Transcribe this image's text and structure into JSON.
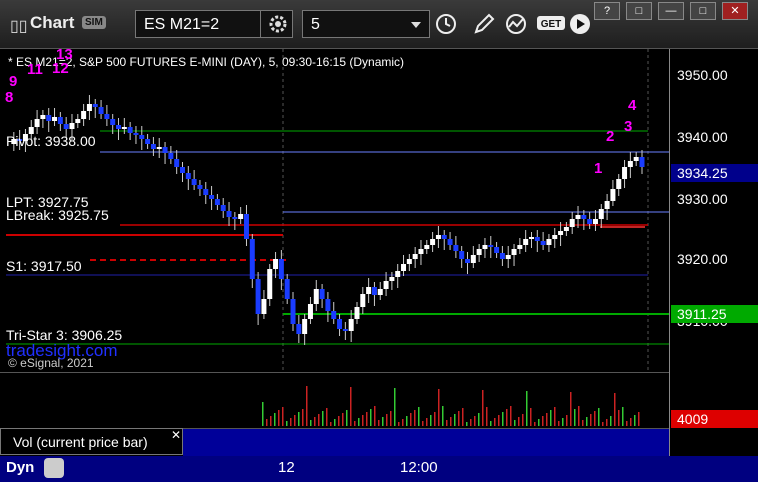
{
  "window": {
    "title": "Chart",
    "sim_badge": "SIM",
    "symbol": "ES M21=2",
    "interval": "5",
    "controls": [
      "?",
      "□",
      "—",
      "□",
      "✕"
    ]
  },
  "chart_header": {
    "description": "* ES M21=2, S&P 500 FUTURES E-MINI (DAY), 5, 09:30-16:15 (Dynamic)"
  },
  "levels": {
    "pivot": "Pivot: 3938.00",
    "lpt": "LPT: 3927.75",
    "lbreak": "LBreak: 3925.75",
    "s1": "S1: 3917.50",
    "tristar": "Tri-Star 3: 3906.25"
  },
  "watermark": {
    "site": "tradesight.com",
    "copyright": "© eSignal, 2021"
  },
  "y_axis": {
    "ticks": [
      "3950.00",
      "3940.00",
      "3930.00",
      "3920.00",
      "3910.00"
    ],
    "last_price": "3934.25",
    "green_tag": "3911.25",
    "volume_tag": "4009",
    "colors": {
      "last_price_bg": "#00008b",
      "green_tag_bg": "#00aa00",
      "volume_tag_bg": "#dd0000"
    }
  },
  "counts": {
    "top_left": [
      "13",
      "12",
      "11",
      "9",
      "8"
    ],
    "right": [
      "1",
      "2",
      "3",
      "4"
    ]
  },
  "volume_panel": {
    "legend": "Vol (current price bar)",
    "close": "✕"
  },
  "time_axis": {
    "labels": [
      "12",
      "12:00"
    ]
  },
  "bottom": {
    "dyn": "Dyn"
  }
}
